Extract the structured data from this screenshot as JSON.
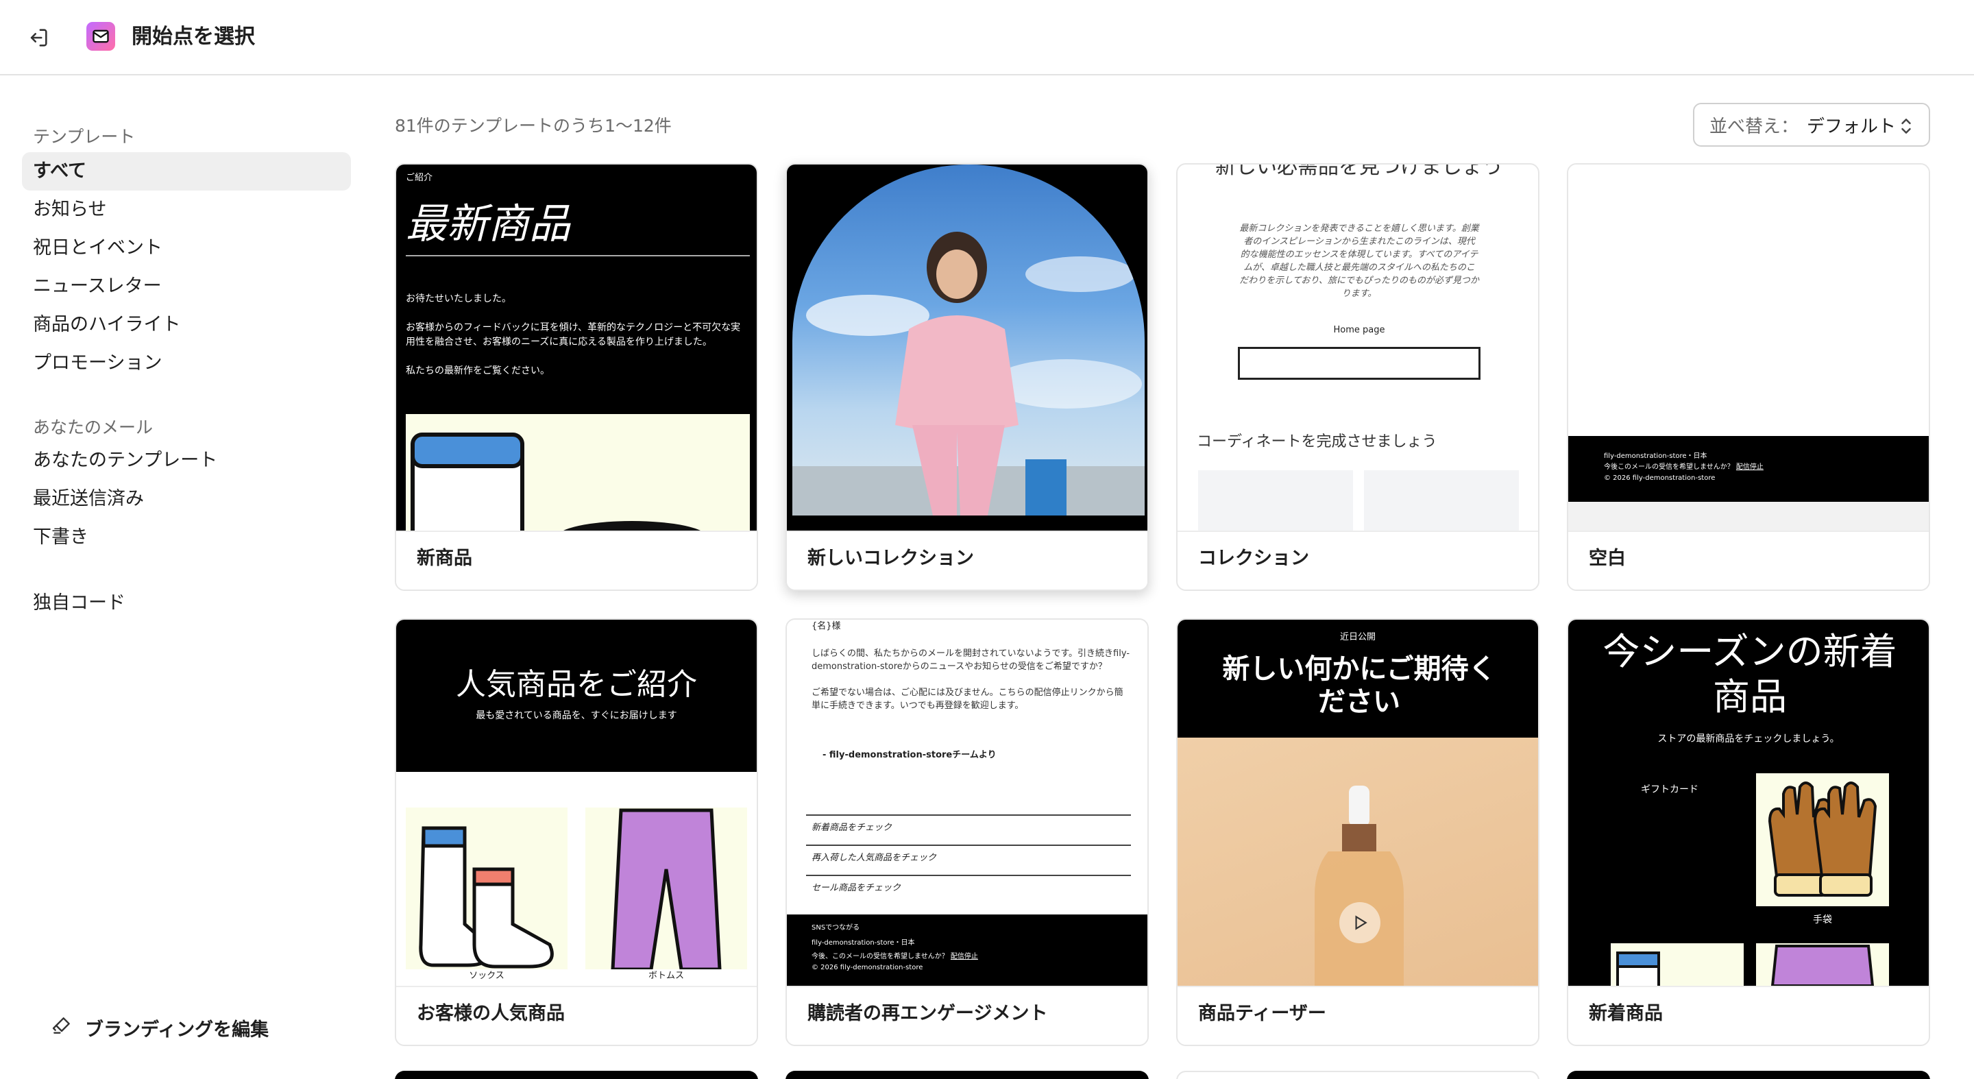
{
  "header": {
    "title": "開始点を選択"
  },
  "sidebar": {
    "section_templates": "テンプレート",
    "items": [
      "すべて",
      "お知らせ",
      "祝日とイベント",
      "ニュースレター",
      "商品のハイライト",
      "プロモーション"
    ],
    "section_mail": "あなたのメール",
    "mail_items": [
      "あなたのテンプレート",
      "最近送信済み",
      "下書き"
    ],
    "custom_code": "独自コード",
    "branding": "ブランディングを編集"
  },
  "main": {
    "count": "81件のテンプレートのうち1〜12件",
    "sort_label": "並べ替え：",
    "sort_value": "デフォルト"
  },
  "cards": [
    {
      "name": "新商品",
      "eyebrow": "ご紹介",
      "title": "最新商品",
      "p1": "お待たせいたしました。",
      "p2": "お客様からのフィードバックに耳を傾け、革新的なテクノロジーと不可欠な実用性を融合させ、お客様のニーズに真に応える製品を作り上げました。",
      "p3": "私たちの最新作をご覧ください。"
    },
    {
      "name": "新しいコレクション"
    },
    {
      "name": "コレクション",
      "title": "新しい必需品を見つけましょう",
      "p": "最新コレクションを発表できることを嬉しく思います。創業者のインスピレーションから生まれたこのラインは、現代的な機能性のエッセンスを体現しています。すべてのアイテムが、卓越した職人技と最先端のスタイルへの私たちのこだわりを示しており、旅にでもぴったりのものが必ず見つかります。",
      "link": "Home page",
      "section": "コーディネートを完成させましょう"
    },
    {
      "name": "空白",
      "footer1": "fily-demonstration-store・日本",
      "footer2": "今後このメールの受信を希望しませんか？",
      "unsub": "配信停止",
      "footer3": "© 2026 fily-demonstration-store"
    },
    {
      "name": "お客様の人気商品",
      "title": "人気商品をご紹介",
      "sub": "最も愛されている商品を、すぐにお届けします",
      "item1": "ソックス",
      "item2": "ボトムス"
    },
    {
      "name": "購読者の再エンゲージメント",
      "greet": "{名}様",
      "p1": "しばらくの間、私たちからのメールを開封されていないようです。引き続きfily-demonstration-storeからのニュースやお知らせの受信をご希望ですか？",
      "p2": "ご希望でない場合は、ご心配には及びません。こちらの配信停止リンクから簡単に手続きできます。いつでも再登録を歓迎します。",
      "sign": "- fily-demonstration-storeチームより",
      "links": [
        "新着商品をチェック",
        "再入荷した人気商品をチェック",
        "セール商品をチェック"
      ],
      "footer0": "SNSでつながる",
      "footer1": "fily-demonstration-store・日本",
      "footer2": "今後、このメールの受信を希望しませんか？",
      "unsub": "配信停止",
      "footer3": "© 2026 fily-demonstration-store"
    },
    {
      "name": "商品ティーザー",
      "eyebrow": "近日公開",
      "title": "新しい何かにご期待ください"
    },
    {
      "name": "新着商品",
      "title": "今シーズンの新着商品",
      "sub": "ストアの最新商品をチェックしましょう。",
      "gift": "ギフトカード",
      "gloves": "手袋"
    }
  ]
}
